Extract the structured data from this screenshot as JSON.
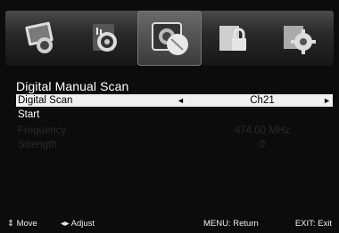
{
  "menu": {
    "title": "Digital Manual Scan",
    "icons": [
      {
        "name": "picture-icon"
      },
      {
        "name": "sound-icon"
      },
      {
        "name": "channel-dish-icon",
        "selected": true
      },
      {
        "name": "lock-icon"
      },
      {
        "name": "setup-gear-icon"
      }
    ],
    "rows": {
      "digital_scan": {
        "label": "Digital Scan",
        "value": "Ch21",
        "left_arrow": "◄",
        "right_arrow": "►"
      },
      "start": {
        "label": "Start"
      },
      "frequency": {
        "label": "Frequency",
        "value": "474.00 MHz"
      },
      "strength": {
        "label": "Strength",
        "value": "0"
      }
    }
  },
  "footer": {
    "move": "⇕ Move",
    "adjust": "◂▸ Adjust",
    "menu": "MENU: Return",
    "exit": "EXIT: Exit"
  }
}
